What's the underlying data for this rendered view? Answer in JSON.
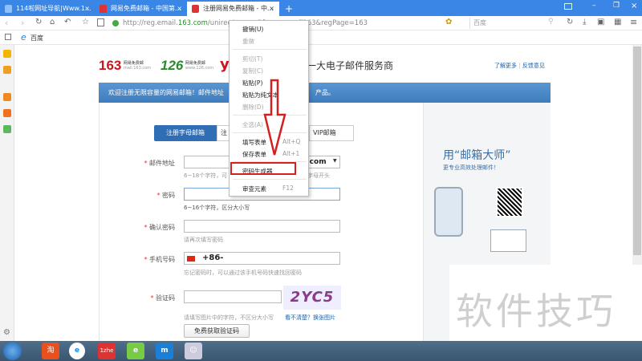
{
  "tabs": [
    {
      "label": "114啦网址导航|Www.1...",
      "close": "×"
    },
    {
      "label": "网易免费邮箱 - 中国第...",
      "close": "×"
    },
    {
      "label": "注册网易免费邮箱 - 中...",
      "close": "×",
      "active": true
    }
  ],
  "new_tab": "+",
  "window_controls": {
    "minimize": "–",
    "restore": "❐",
    "close": "×"
  },
  "address": {
    "prefix": "http://reg.email.",
    "domain": "163.com",
    "path": "/unireg/...ance&from=email163&regPage=163"
  },
  "search": {
    "placeholder": "百度"
  },
  "bookmarks": [
    {
      "label": "百度"
    }
  ],
  "header": {
    "logo163": "163",
    "logo163_sub": "网易免费邮",
    "logo163_url": "mail.163.com",
    "logo126": "126",
    "logo126_sub": "网易免费邮",
    "logo126_url": "www.126.com",
    "logo_yeah": "y",
    "slogan": "第一大电子邮件服务商",
    "link_more": "了解更多",
    "link_sep": "|",
    "link_feedback": "反馈意见"
  },
  "banner": {
    "left": "欢迎注册无限容量的网易邮箱！邮件地址",
    "right": "产品。"
  },
  "form": {
    "tabs": [
      "注册字母邮箱",
      "注",
      "VIP邮箱"
    ],
    "email_label": "邮件地址",
    "email_domain": "3.com",
    "email_hint": "6~18个字符，可",
    "email_hint_end": "字母开头",
    "password_label": "密码",
    "password_hint": "6~16个字符，区分大小写",
    "confirm_label": "确认密码",
    "confirm_hint": "请再次填写密码",
    "phone_label": "手机号码",
    "phone_prefix": "+86-",
    "phone_hint": "忘记密码时，可以通过该手机号码快速找回密码",
    "captcha_label": "验证码",
    "captcha_text": "2YC5",
    "captcha_refresh": "看不清楚？换张图片",
    "captcha_hint": "请填写图片中的字符，不区分大小写",
    "sms_button": "免费获取验证码",
    "required": "*"
  },
  "promo": {
    "title": "用“邮箱大师”",
    "subtitle": "更专业高效处理邮件！"
  },
  "context_menu": [
    {
      "label": "撤销(U)",
      "enabled": true
    },
    {
      "label": "重做",
      "enabled": false
    },
    {
      "label": "剪切(T)",
      "enabled": false
    },
    {
      "label": "复制(C)",
      "enabled": false
    },
    {
      "label": "粘贴(P)",
      "enabled": true
    },
    {
      "label": "粘贴为纯文本",
      "enabled": true
    },
    {
      "label": "删除(D)",
      "enabled": false
    },
    {
      "label": "全选(A)",
      "enabled": false
    },
    {
      "label": "填写表单",
      "shortcut": "Alt+Q",
      "enabled": true
    },
    {
      "label": "保存表单",
      "shortcut": "Alt+1",
      "enabled": true
    },
    {
      "label": "密码生成器",
      "enabled": true
    },
    {
      "label": "审查元素",
      "shortcut": "F12",
      "enabled": true
    }
  ],
  "watermark": "软件技巧",
  "taskbar": [
    {
      "label": "淘"
    },
    {
      "label": "e"
    },
    {
      "label": "1zhe"
    },
    {
      "label": "e"
    },
    {
      "label": "m"
    },
    {
      "label": "☺"
    }
  ],
  "colors": {
    "tabbar": "#3a86e6",
    "banner": "#4a86c5",
    "highlight": "#d42020"
  }
}
